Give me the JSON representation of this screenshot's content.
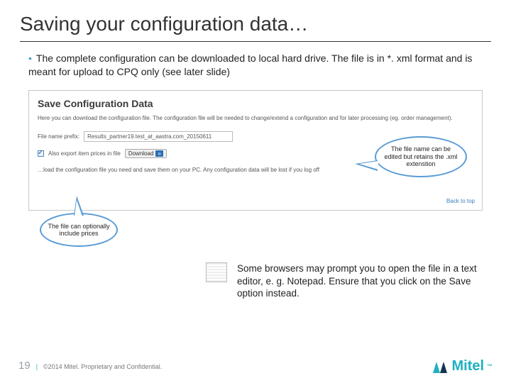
{
  "title": "Saving your configuration data…",
  "bullet": "The complete configuration can be downloaded to local hard drive. The file is in *. xml format and is meant for upload to CPQ only (see later slide)",
  "screenshot": {
    "heading": "Save Configuration Data",
    "description": "Here you can download the configuration file. The configuration file will be needed to change/extend a configuration and for later processing (eg. order management).",
    "prefix_label": "File name prefix:",
    "filename": "Results_partner19.test_at_aastra.com_20150611",
    "export_label": "Also export item prices in file",
    "download_label": "Download",
    "foot_text": "…load the configuration file you need and save them on your PC. Any configuration data will be lost if you log off",
    "back_to_top": "Back to top"
  },
  "callouts": {
    "filename_note": "The file name can be edited but retains the .xml extenstion",
    "prices_note": "The file can optionally include prices"
  },
  "note": "Some browsers may prompt you to open the file in a text editor, e. g. Notepad. Ensure that you click on the Save option instead.",
  "footer": {
    "page_number": "19",
    "separator": "|",
    "copyright": "©2014 Mitel. Proprietary and Confidential."
  },
  "logo": {
    "text": "Mitel",
    "tm": "™"
  }
}
